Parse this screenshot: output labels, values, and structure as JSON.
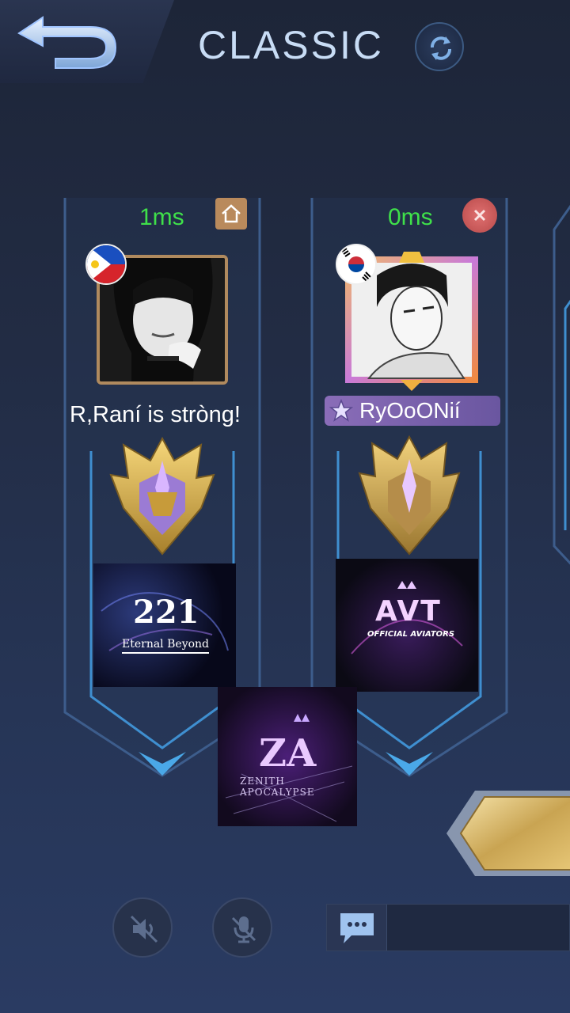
{
  "header": {
    "title": "CLASSIC"
  },
  "players": [
    {
      "ping": "1ms",
      "name": "R,Raní is stròng!",
      "flag": "Philippines",
      "is_host": true,
      "squad": {
        "number": "221",
        "name": "Eternal Beyond"
      }
    },
    {
      "ping": "0ms",
      "name": "RyOoONií",
      "flag": "South Korea",
      "is_host": false,
      "squad": {
        "abbr": "AVT",
        "name": "OFFICIAL AVIATORS"
      }
    }
  ],
  "spectator_squad": {
    "abbr": "ZA",
    "name": "ZENITH APOCALYPSE"
  },
  "icons": {
    "back": "back-arrow-icon",
    "refresh": "refresh-icon",
    "host": "home-icon",
    "kick": "close-icon",
    "speaker": "speaker-muted-icon",
    "mic": "mic-muted-icon",
    "chat": "chat-icon"
  },
  "colors": {
    "ping": "#3fe04a",
    "title": "#c8dcf5",
    "frame_blue": "#3f8fd0"
  }
}
